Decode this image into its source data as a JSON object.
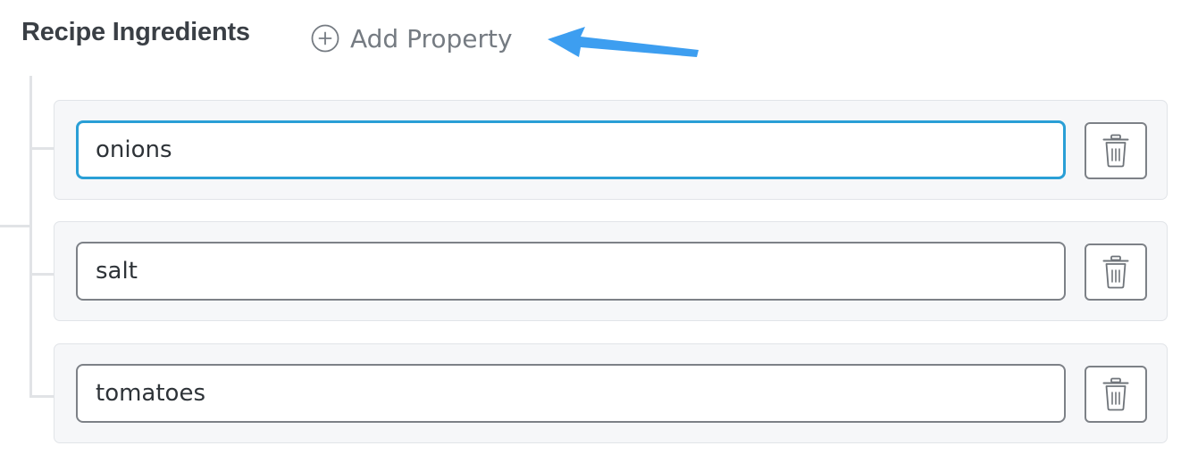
{
  "section": {
    "title": "Recipe Ingredients"
  },
  "add_property": {
    "label": "Add Property",
    "icon": "plus-circle-icon"
  },
  "annotation": {
    "type": "arrow",
    "color": "#3d9ef0"
  },
  "items": [
    {
      "value": "onions",
      "focused": true
    },
    {
      "value": "salt",
      "focused": false
    },
    {
      "value": "tomatoes",
      "focused": false
    }
  ],
  "delete_icon": "trash-icon",
  "colors": {
    "focus_border": "#2a9fd6",
    "input_border": "#7d8187",
    "row_background": "#f6f7f9",
    "arrow": "#3d9ef0"
  }
}
